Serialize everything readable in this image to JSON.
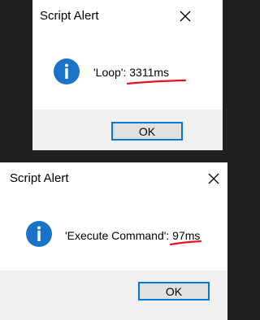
{
  "dialogs": [
    {
      "title": "Script Alert",
      "message": "'Loop': 3311ms",
      "ok_label": "OK"
    },
    {
      "title": "Script Alert",
      "message": "'Execute Command': 97ms",
      "ok_label": "OK"
    }
  ],
  "icons": {
    "info": "info-icon",
    "close": "close-icon"
  },
  "colors": {
    "background": "#202020",
    "dialog": "#ffffff",
    "footer": "#f0f0f0",
    "info_icon": "#1a73c9",
    "button_border": "#0078d7",
    "button_face": "#e1e1e1",
    "annotation": "#e81123"
  }
}
